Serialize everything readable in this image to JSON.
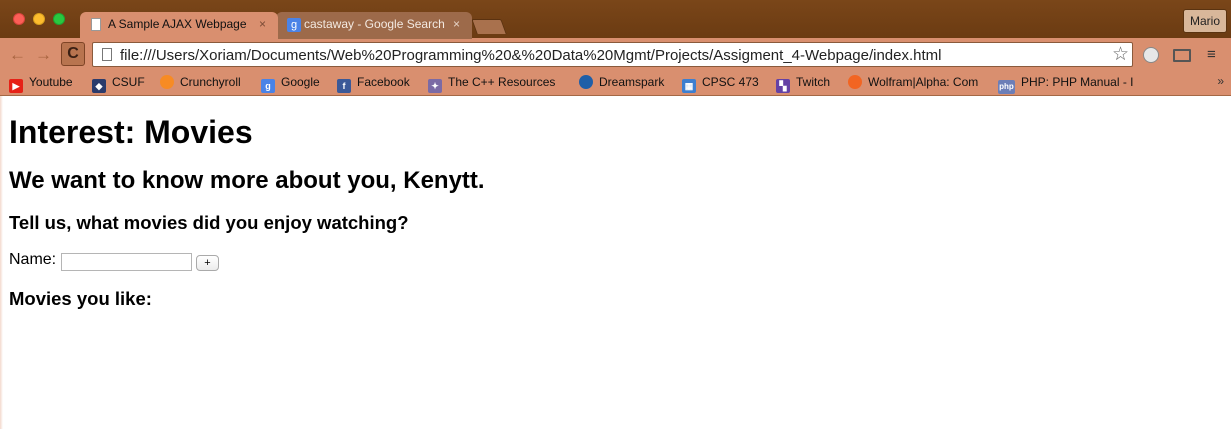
{
  "browser": {
    "tabs": [
      {
        "title": "A Sample AJAX Webpage",
        "close": "×",
        "active": true
      },
      {
        "title": "castaway - Google Search",
        "close": "×",
        "active": false
      }
    ],
    "user_button": "Mario",
    "url": "file:///Users/Xoriam/Documents/Web%20Programming%20&%20Data%20Mgmt/Projects/Assigment_4-Webpage/index.html",
    "nav": {
      "back": "←",
      "forward": "→",
      "reload": "C",
      "star": "☆",
      "menu": "≡"
    },
    "bookmarks": [
      {
        "label": "Youtube",
        "icon": "youtube-icon",
        "color": "#e62117",
        "glyph": "▶"
      },
      {
        "label": "CSUF",
        "icon": "csuf-icon",
        "color": "#2b3b6b",
        "glyph": "◆"
      },
      {
        "label": "Crunchyroll",
        "icon": "crunchyroll-icon",
        "color": "#f78b24",
        "glyph": "●"
      },
      {
        "label": "Google",
        "icon": "google-icon",
        "color": "#4a83e7",
        "glyph": "g"
      },
      {
        "label": "Facebook",
        "icon": "facebook-icon",
        "color": "#3b5998",
        "glyph": "f"
      },
      {
        "label": "The C++ Resources",
        "icon": "cpp-icon",
        "color": "#7b6aa5",
        "glyph": "✦"
      },
      {
        "label": "Dreamspark",
        "icon": "dreamspark-icon",
        "color": "#1f5fa8",
        "glyph": "◉"
      },
      {
        "label": "CPSC 473",
        "icon": "cpsc-icon",
        "color": "#3d7fd0",
        "glyph": "▦"
      },
      {
        "label": "Twitch",
        "icon": "twitch-icon",
        "color": "#6441a5",
        "glyph": "▚"
      },
      {
        "label": "Wolfram|Alpha: Com",
        "icon": "wolfram-icon",
        "color": "#f26522",
        "glyph": "✹"
      },
      {
        "label": "PHP: PHP Manual - I",
        "icon": "php-icon",
        "color": "#6c7eb7",
        "glyph": "php"
      }
    ],
    "bookmarks_more": "»"
  },
  "page": {
    "title": "Interest: Movies",
    "subtitle": "We want to know more about you, Kenytt.",
    "prompt": "Tell us, what movies did you enjoy watching?",
    "name_label": "Name:",
    "name_value": "",
    "add_label": "+",
    "list_heading": "Movies you like:"
  }
}
